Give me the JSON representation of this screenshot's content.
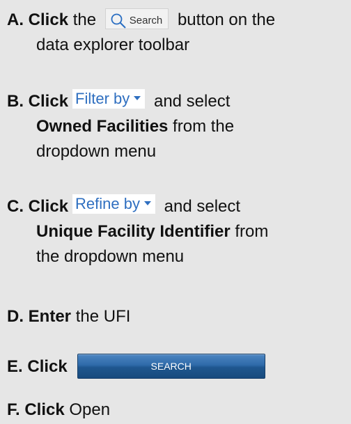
{
  "steps": {
    "a": {
      "letter": "A.",
      "action": "Click",
      "pre": " the ",
      "chip_label": "Search",
      "post": " button on the",
      "line2": "data explorer toolbar"
    },
    "b": {
      "letter": "B.",
      "action": "Click",
      "chip_label": "Filter by",
      "post": " and select",
      "bold_line": "Owned Facilities",
      "bold_suffix": " from the",
      "line3": "dropdown menu"
    },
    "c": {
      "letter": "C.",
      "action": "Click",
      "chip_label": "Refine by",
      "post": " and select",
      "bold_line": "Unique Facility Identifier",
      "bold_suffix": " from",
      "line3": "the dropdown menu"
    },
    "d": {
      "letter": "D.",
      "action": "Enter",
      "post": " the UFI"
    },
    "e": {
      "letter": "E.",
      "action": "Click",
      "button_label": "SEARCH"
    },
    "f": {
      "letter": "F.",
      "action": "Click",
      "post": " Open"
    }
  },
  "colors": {
    "background": "#e6e6e6",
    "link_blue": "#2f6fc0",
    "button_blue": "#2e6aa9"
  },
  "icons": {
    "search": "magnifier-icon",
    "dropdown": "caret-down-icon"
  }
}
